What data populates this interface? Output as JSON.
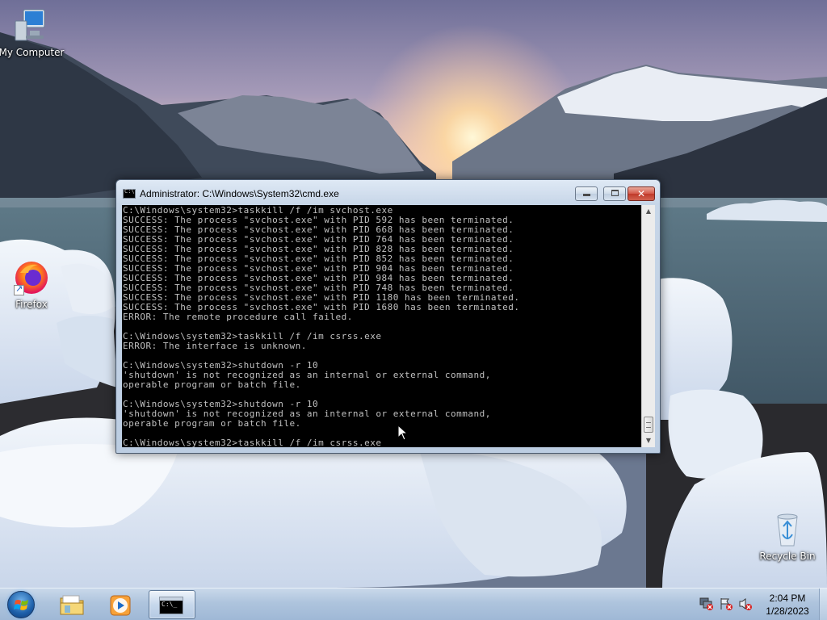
{
  "desktop": {
    "icons": [
      {
        "label": "My Computer",
        "icon": "computer-icon"
      },
      {
        "label": "Firefox",
        "icon": "firefox-icon"
      },
      {
        "label": "Recycle Bin",
        "icon": "recycle-bin-icon"
      }
    ]
  },
  "cmd_window": {
    "title": "Administrator: C:\\Windows\\System32\\cmd.exe",
    "icon": "cmd-icon",
    "lines": [
      "C:\\Windows\\system32>taskkill /f /im svchost.exe",
      "SUCCESS: The process \"svchost.exe\" with PID 592 has been terminated.",
      "SUCCESS: The process \"svchost.exe\" with PID 668 has been terminated.",
      "SUCCESS: The process \"svchost.exe\" with PID 764 has been terminated.",
      "SUCCESS: The process \"svchost.exe\" with PID 828 has been terminated.",
      "SUCCESS: The process \"svchost.exe\" with PID 852 has been terminated.",
      "SUCCESS: The process \"svchost.exe\" with PID 904 has been terminated.",
      "SUCCESS: The process \"svchost.exe\" with PID 984 has been terminated.",
      "SUCCESS: The process \"svchost.exe\" with PID 748 has been terminated.",
      "SUCCESS: The process \"svchost.exe\" with PID 1180 has been terminated.",
      "SUCCESS: The process \"svchost.exe\" with PID 1680 has been terminated.",
      "ERROR: The remote procedure call failed.",
      "",
      "C:\\Windows\\system32>taskkill /f /im csrss.exe",
      "ERROR: The interface is unknown.",
      "",
      "C:\\Windows\\system32>shutdown -r 10",
      "'shutdown' is not recognized as an internal or external command,",
      "operable program or batch file.",
      "",
      "C:\\Windows\\system32>shutdown -r 10",
      "'shutdown' is not recognized as an internal or external command,",
      "operable program or batch file.",
      "",
      "C:\\Windows\\system32>taskkill /f /im csrss.exe"
    ]
  },
  "taskbar": {
    "pinned": [
      {
        "name": "explorer",
        "icon": "folder-icon"
      },
      {
        "name": "media-player",
        "icon": "media-player-icon"
      },
      {
        "name": "cmd",
        "icon": "cmd-icon",
        "active": true
      }
    ],
    "tray_icons": [
      "network-error-icon",
      "action-center-error-icon",
      "volume-muted-icon"
    ],
    "clock": {
      "time": "2:04 PM",
      "date": "1/28/2023"
    }
  }
}
